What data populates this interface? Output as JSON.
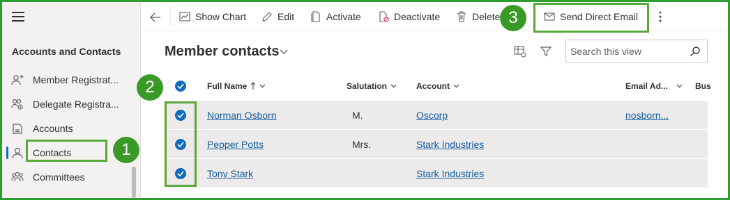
{
  "sidebar": {
    "section_title": "Accounts and Contacts",
    "items": [
      {
        "label": "Member Registrat...",
        "icon": "person-add-icon"
      },
      {
        "label": "Delegate Registra...",
        "icon": "people-settings-icon"
      },
      {
        "label": "Accounts",
        "icon": "document-icon"
      },
      {
        "label": "Contacts",
        "icon": "person-icon",
        "active": true
      },
      {
        "label": "Committees",
        "icon": "people-team-icon"
      }
    ]
  },
  "toolbar": {
    "show_chart": "Show Chart",
    "edit": "Edit",
    "activate": "Activate",
    "deactivate": "Deactivate",
    "delete": "Delete",
    "send_direct_email": "Send Direct Email"
  },
  "view": {
    "title": "Member contacts",
    "search_placeholder": "Search this view"
  },
  "grid": {
    "columns": {
      "full_name": "Full Name",
      "salutation": "Salutation",
      "account": "Account",
      "email": "Email Ad...",
      "business": "Bus"
    },
    "rows": [
      {
        "full_name": "Norman Osborn",
        "salutation": "M.",
        "account": "Oscorp",
        "email": "nosborn...",
        "selected": true
      },
      {
        "full_name": "Pepper Potts",
        "salutation": "Mrs.",
        "account": "Stark Industries",
        "email": "",
        "selected": true
      },
      {
        "full_name": "Tony Stark",
        "salutation": "",
        "account": "Stark Industries",
        "email": "",
        "selected": true
      }
    ]
  },
  "annotations": {
    "markers": [
      "1",
      "2",
      "3"
    ]
  },
  "colors": {
    "accent": "#0f6cbd",
    "link": "#115ea3",
    "annotation_green": "#3a9a28",
    "row_bg": "#edebe9"
  }
}
